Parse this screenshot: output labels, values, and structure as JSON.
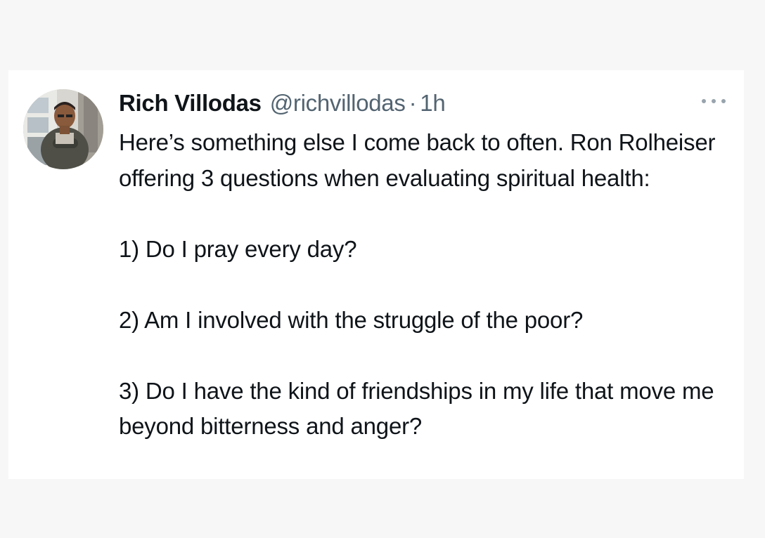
{
  "tweet": {
    "author_name": "Rich Villodas",
    "author_handle": "@richvillodas",
    "separator": "·",
    "time": "1h",
    "more_icon": "more-horizontal-icon",
    "text": {
      "intro": "Here’s something else I come back to often. Ron Rolheiser offering 3 questions when evaluating spiritual health:",
      "question_1": "1) Do I pray every day?",
      "question_2": "2) Am I involved with the struggle of the poor?",
      "question_3": "3) Do I have the kind of friendships in my life that move me beyond bitterness and anger?"
    }
  },
  "colors": {
    "page_background": "#f7f7f8",
    "card_background": "#ffffff",
    "primary_text": "#0f1419",
    "secondary_text": "#536471"
  }
}
